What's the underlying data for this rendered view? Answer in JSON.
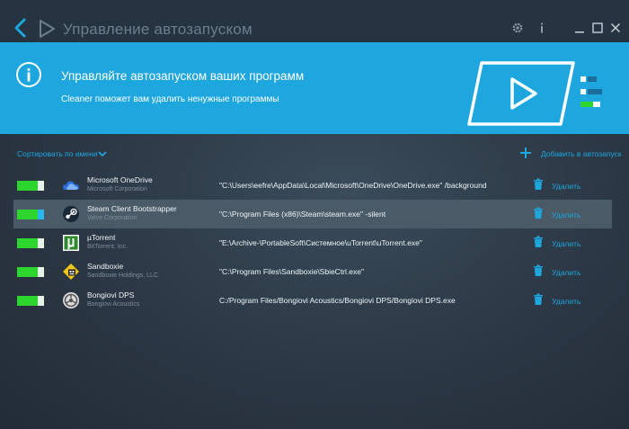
{
  "window": {
    "title": "Управление автозапуском"
  },
  "banner": {
    "title": "Управляйте автозапуском ваших программ",
    "subtitle": "Cleaner поможет вам удалить ненужные программы"
  },
  "toolbar": {
    "sort_label": "Сортировать по имени",
    "add_label": "Добавить в автозапуск"
  },
  "colors": {
    "accent": "#1ea6df",
    "toggle_on": "#2ed52e",
    "background": "#2b3744",
    "selected_row": "#4b5a67"
  },
  "startup_items": [
    {
      "name": "Microsoft OneDrive",
      "vendor": "Microsoft Corporation",
      "path": "\"C:\\Users\\eefre\\AppData\\Local\\Microsoft\\OneDrive\\OneDrive.exe\" /background",
      "enabled": true,
      "icon": "onedrive-cloud-icon",
      "delete_label": "Удалить"
    },
    {
      "name": "Steam Client Bootstrapper",
      "vendor": "Valve Corporation",
      "path": "\"C:\\Program Files (x86)\\Steam\\steam.exe\" -silent",
      "enabled": true,
      "icon": "steam-icon",
      "delete_label": "Удалить"
    },
    {
      "name": "µTorrent",
      "vendor": "BitTorrent, Inc.",
      "path": "\"E:\\Archive-\\PortableSoft\\Системное\\uTorrent\\uTorrent.exe\"",
      "enabled": true,
      "icon": "utorrent-icon",
      "delete_label": "Удалить"
    },
    {
      "name": "Sandboxie",
      "vendor": "Sandboxie Holdings, LLC",
      "path": "\"C:\\Program Files\\Sandboxie\\SbieCtrl.exe\"",
      "enabled": true,
      "icon": "sandboxie-icon",
      "delete_label": "Удалить"
    },
    {
      "name": "Bongiovi DPS",
      "vendor": "Bongiovi Acoustics",
      "path": "C:/Program Files/Bongiovi Acoustics/Bongiovi DPS/Bongiovi DPS.exe",
      "enabled": true,
      "icon": "bongiovi-icon",
      "delete_label": "Удалить"
    }
  ]
}
